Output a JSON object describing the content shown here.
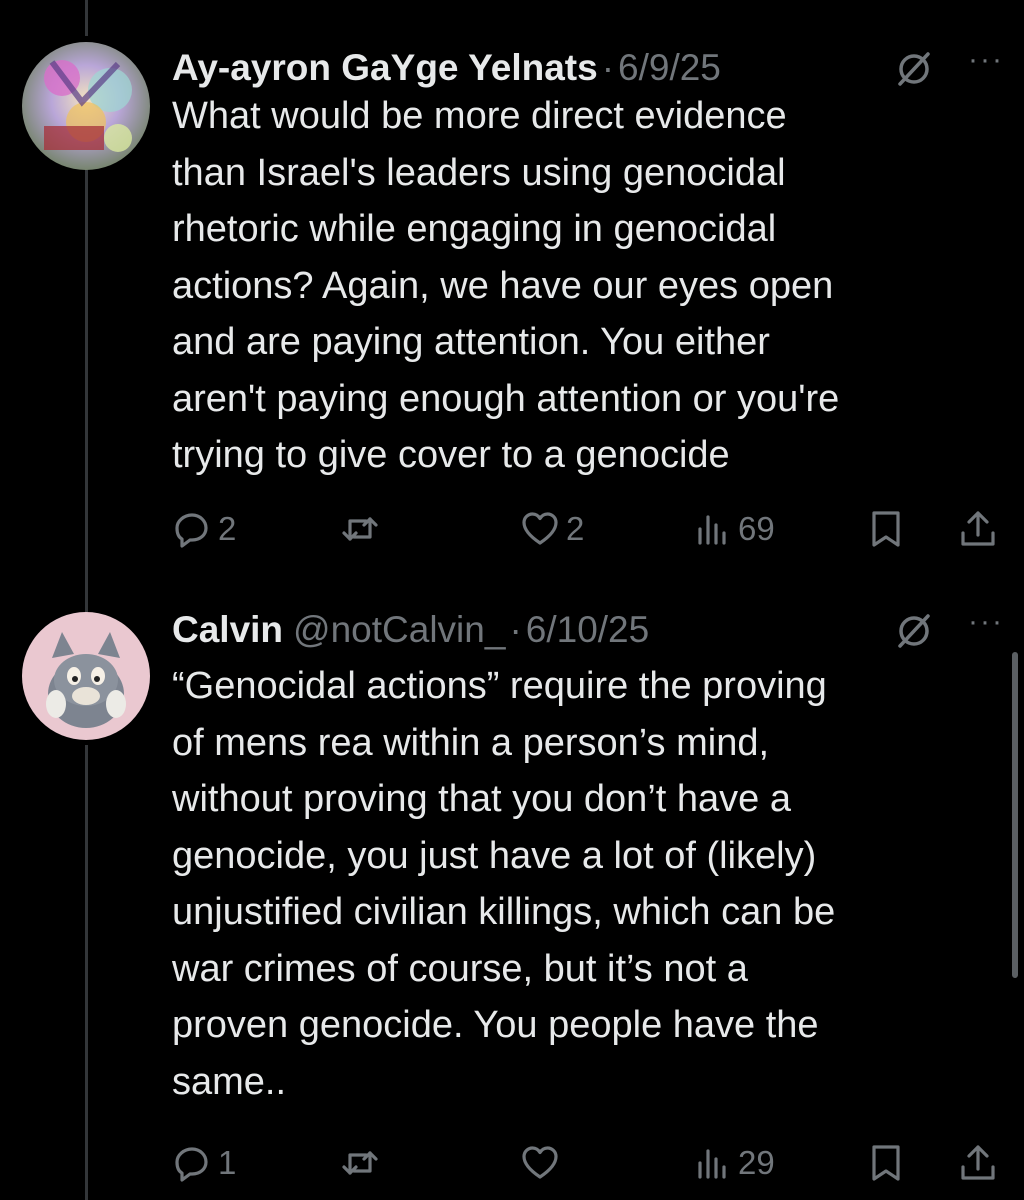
{
  "tweets": [
    {
      "author_name": "Ay-ayron GaYge Yelnats",
      "handle": "",
      "separator": "·",
      "date": "6/9/25",
      "text": "What would be more direct evidence\nthan Israel's leaders using genocidal\nrhetoric while engaging in genocidal\nactions? Again, we have our eyes open\nand are paying attention. You either\naren't paying enough attention or you're\ntrying to give cover to a genocide",
      "replies": "2",
      "reposts": "",
      "likes": "2",
      "views": "69"
    },
    {
      "author_name": "Calvin",
      "handle": "@notCalvin_",
      "separator": "·",
      "date": "6/10/25",
      "text": "“Genocidal actions” require the proving\nof mens rea within a person’s mind,\nwithout proving that you don’t have a\ngenocide, you just have a lot of (likely)\nunjustified civilian killings, which can be\nwar crimes of course, but it’s not a\nproven genocide. You people have the\nsame..",
      "replies": "1",
      "reposts": "",
      "likes": "",
      "views": "29"
    }
  ],
  "icons": {
    "reply": "reply-icon",
    "repost": "repost-icon",
    "like": "heart-icon",
    "views": "views-icon",
    "bookmark": "bookmark-icon",
    "share": "share-icon",
    "grok": "grok-icon",
    "more": "more-icon"
  },
  "more_glyph": "···",
  "colors": {
    "background": "#000000",
    "text": "#e7e9ea",
    "secondary": "#71767b",
    "thread_line": "#333639"
  }
}
